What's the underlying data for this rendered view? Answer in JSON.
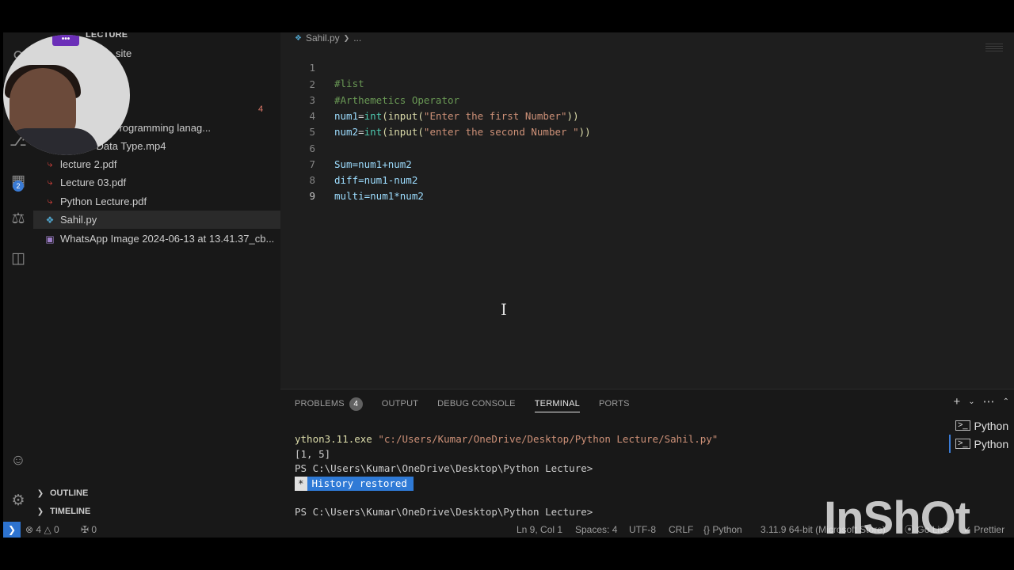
{
  "sidebar": {
    "header": "LECTURE",
    "partial_item": "site",
    "problem_count": "4",
    "files": [
      {
        "name": "to Pythong Programming lanag...",
        "type": "video"
      },
      {
        "name": "various Data Type.mp4",
        "type": "video"
      },
      {
        "name": "lecture 2.pdf",
        "type": "pdf"
      },
      {
        "name": "Lecture 03.pdf",
        "type": "pdf"
      },
      {
        "name": "Python Lecture.pdf",
        "type": "pdf"
      },
      {
        "name": "Sahil.py",
        "type": "python"
      },
      {
        "name": "WhatsApp Image 2024-06-13 at 13.41.37_cb...",
        "type": "image"
      }
    ],
    "outline_label": "OUTLINE",
    "timeline_label": "TIMELINE"
  },
  "activity_bar": {
    "extensions_badge": "2",
    "icons": [
      "search-icon",
      "source-control-icon",
      "extensions-icon",
      "testing-icon",
      "notebook-icon",
      "account-icon",
      "settings-gear-icon"
    ]
  },
  "editor": {
    "breadcrumb_file": "Sahil.py",
    "breadcrumb_rest": "...",
    "line_numbers": [
      "1",
      "2",
      "3",
      "4",
      "5",
      "6",
      "7",
      "8",
      "9"
    ],
    "lines": {
      "l1": "#list",
      "l2": "#Arthemetics Operator",
      "l3_var": "num1",
      "l3_eq": "=",
      "l3_int": "int",
      "l3_p1": "(",
      "l3_input": "input",
      "l3_p2": "(",
      "l3_str": "\"Enter the first Number\"",
      "l3_close": "))",
      "l4_var": "num2",
      "l4_eq": "=",
      "l4_int": "int",
      "l4_p1": "(",
      "l4_input": "input",
      "l4_p2": "(",
      "l4_str": "\"enter the second Number \"",
      "l4_close": "))",
      "l6": "Sum=num1+num2",
      "l7": "diff=num1-num2",
      "l8": "multi=num1*num2"
    }
  },
  "panel": {
    "tabs": {
      "problems": "PROBLEMS",
      "problems_count": "4",
      "output": "OUTPUT",
      "debug_console": "DEBUG CONSOLE",
      "terminal": "TERMINAL",
      "ports": "PORTS"
    },
    "terminal": {
      "line1_exe": "ython3.11.exe",
      "line1_path": "\"c:/Users/Kumar/OneDrive/Desktop/Python Lecture/Sahil.py\"",
      "line2": "[1, 5]",
      "line3": "PS C:\\Users\\Kumar\\OneDrive\\Desktop\\Python Lecture>",
      "history_star": "*",
      "history": "History restored",
      "line5": "PS C:\\Users\\Kumar\\OneDrive\\Desktop\\Python Lecture>"
    },
    "terminal_list": [
      "Python",
      "Python"
    ]
  },
  "status_bar": {
    "remote_icon": "remote-icon",
    "errors": "4",
    "warnings": "0",
    "ports": "0",
    "position": "Ln 9, Col 1",
    "spaces": "Spaces: 4",
    "encoding": "UTF-8",
    "eol": "CRLF",
    "language": "Python",
    "interpreter": "3.11.9 64-bit (Microsoft Store)",
    "go_live": "Go Live",
    "prettier": "Prettier"
  },
  "watermark": "InShOt",
  "colors": {
    "accent": "#2d73d0",
    "editor_bg": "#1e1e1e",
    "sidebar_bg": "#181818",
    "comment": "#6a9955",
    "string": "#ce9178",
    "variable": "#9cdcfe",
    "function": "#dcdcaa"
  }
}
